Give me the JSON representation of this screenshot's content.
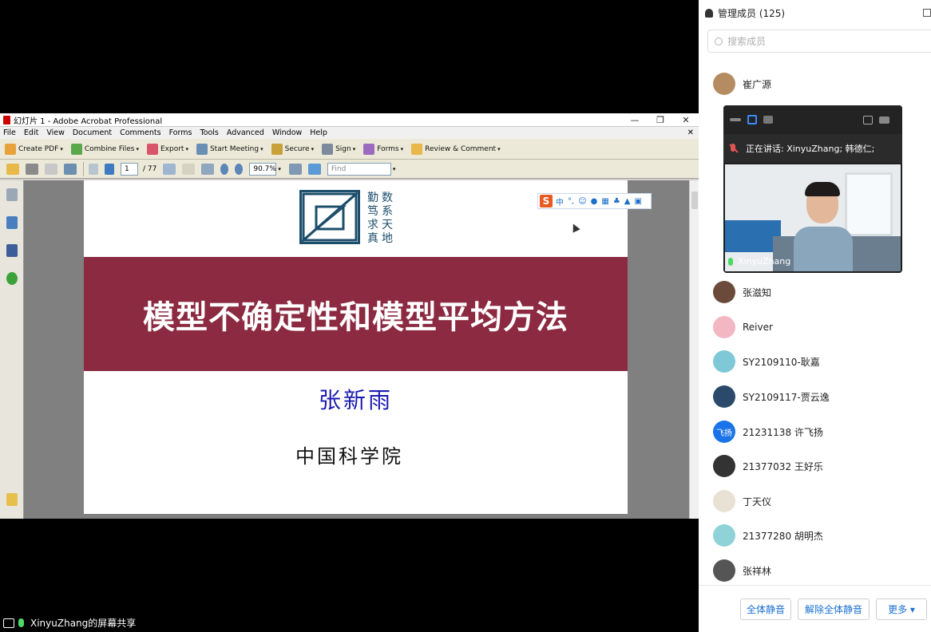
{
  "acrobat": {
    "title": "幻灯片 1 - Adobe Acrobat Professional",
    "window_controls": [
      "—",
      "❐",
      "✕"
    ],
    "menu": [
      "File",
      "Edit",
      "View",
      "Document",
      "Comments",
      "Forms",
      "Tools",
      "Advanced",
      "Window",
      "Help"
    ],
    "toolbar1": [
      "Create PDF",
      "Combine Files",
      "Export",
      "Start Meeting",
      "Secure",
      "Sign",
      "Forms",
      "Review & Comment"
    ],
    "page_current": "1",
    "page_total": "/ 77",
    "zoom": "90.7%",
    "find_placeholder": "Find"
  },
  "slide": {
    "logo_chars": [
      "勤",
      "数",
      "笃",
      "系",
      "求",
      "天",
      "真",
      "地"
    ],
    "title": "模型不确定性和模型平均方法",
    "author": "张新雨",
    "org": "中国科学院",
    "ime_label": "中",
    "ime_extra": "°,"
  },
  "sharebar": {
    "label": "XinyuZhang的屏幕共享"
  },
  "panel": {
    "title": "管理成员 (125)",
    "search_placeholder": "搜索成员",
    "members": [
      {
        "name": "崔广源",
        "color": "#b58c62",
        "avatar": ""
      },
      {
        "name": "张滋知",
        "color": "#6b4a3a",
        "avatar": ""
      },
      {
        "name": "Reiver",
        "color": "#f2b7c2",
        "avatar": ""
      },
      {
        "name": "SY2109110-耿嘉",
        "color": "#7ec8d8",
        "avatar": ""
      },
      {
        "name": "SY2109117-贾云逸",
        "color": "#2b4a6b",
        "avatar": ""
      },
      {
        "name": "21231138 许飞扬",
        "color": "#1a73e8",
        "avatar": "飞扬"
      },
      {
        "name": "21377032 王好乐",
        "color": "#333333",
        "avatar": ""
      },
      {
        "name": "丁天仪",
        "color": "#e9e2d4",
        "avatar": ""
      },
      {
        "name": "21377280 胡明杰",
        "color": "#8fd3d8",
        "avatar": ""
      },
      {
        "name": "张祥林",
        "color": "#555555",
        "avatar": ""
      }
    ],
    "buttons": [
      "全体静音",
      "解除全体静音",
      "更多 ▾"
    ]
  },
  "video": {
    "speaking": "正在讲话: XinyuZhang; 韩德仁;",
    "name": "XinyuZhang"
  }
}
